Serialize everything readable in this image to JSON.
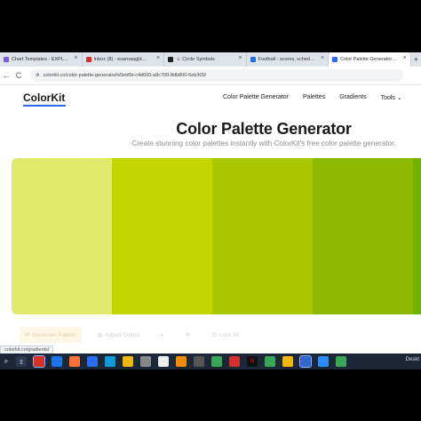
{
  "browser": {
    "tabs": [
      {
        "title": "Chart Templates - EXPLORATIO",
        "color": "#7b5cd6"
      },
      {
        "title": "Inbox (8) - esaroaag|d@gmail.c",
        "color": "#d93025"
      },
      {
        "title": "☺ Circle Symbols",
        "color": "#222222"
      },
      {
        "title": "Football - scores, schedule & ...",
        "color": "#1a73e8"
      },
      {
        "title": "Color Palette Generator - Crea",
        "color": "#2a6df4",
        "active": true
      }
    ],
    "new_tab": "+",
    "nav": {
      "back": "←",
      "reload": "C"
    },
    "url": "colorkit.co/color-palette-generator/e0eb6b-c4d600-a9c700-8db800-6eb300/"
  },
  "site": {
    "logo": "ColorKit",
    "nav": [
      "Color Palette Generator",
      "Palettes",
      "Gradients",
      "Tools"
    ],
    "title": "Color Palette Generator",
    "subtitle": "Create stunning color palettes instantly with ColorKit's free color palette generator."
  },
  "palette": {
    "colors": [
      "#e0eb6b",
      "#c4d600",
      "#a9c700",
      "#8db800",
      "#6eb300"
    ]
  },
  "toolbar": {
    "generate": "Generate Palette",
    "adjust": "Adjust Colors",
    "lock_all": "Lock All"
  },
  "status_url": "colorkit.co/gradients/",
  "taskbar": {
    "search": "⌕",
    "apps": [
      "#d93025",
      "#1a73e8",
      "#f4b400",
      "#2a6df4",
      "#4285f4",
      "#333333",
      "#f2b705",
      "#999999",
      "#2e7d32",
      "#d32f2f",
      "#444444",
      "#c0392b",
      "#3aa757",
      "#f2b705",
      "#3366cc",
      "#2d8cff",
      "#3aa757"
    ],
    "label": "Deskt"
  }
}
